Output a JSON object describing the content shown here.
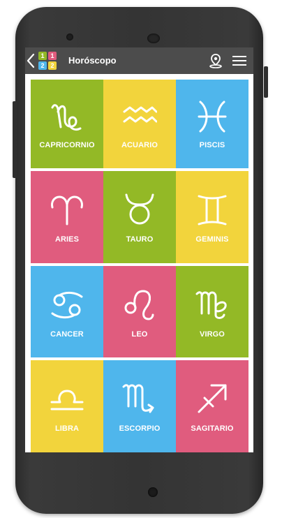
{
  "app": {
    "title": "Horóscopo",
    "logo_digits": [
      "1",
      "1",
      "2",
      "2"
    ]
  },
  "icons": {
    "back": "chevron-left-icon",
    "location": "location-pin-icon",
    "menu": "hamburger-menu-icon"
  },
  "colors": {
    "green": "#93b926",
    "yellow": "#f2d43c",
    "blue": "#4fb6ec",
    "pink": "#e05c7e",
    "appbar": "#4c4c4c"
  },
  "signs": [
    {
      "name": "CAPRICORNIO",
      "icon": "capricorn-icon",
      "color": "#93b926"
    },
    {
      "name": "ACUARIO",
      "icon": "aquarius-icon",
      "color": "#f2d43c"
    },
    {
      "name": "PISCIS",
      "icon": "pisces-icon",
      "color": "#4fb6ec"
    },
    {
      "name": "ARIES",
      "icon": "aries-icon",
      "color": "#e05c7e"
    },
    {
      "name": "TAURO",
      "icon": "taurus-icon",
      "color": "#93b926"
    },
    {
      "name": "GEMINIS",
      "icon": "gemini-icon",
      "color": "#f2d43c"
    },
    {
      "name": "CANCER",
      "icon": "cancer-icon",
      "color": "#4fb6ec"
    },
    {
      "name": "LEO",
      "icon": "leo-icon",
      "color": "#e05c7e"
    },
    {
      "name": "VIRGO",
      "icon": "virgo-icon",
      "color": "#93b926"
    },
    {
      "name": "LIBRA",
      "icon": "libra-icon",
      "color": "#f2d43c"
    },
    {
      "name": "ESCORPIO",
      "icon": "scorpio-icon",
      "color": "#4fb6ec"
    },
    {
      "name": "SAGITARIO",
      "icon": "sagittarius-icon",
      "color": "#e05c7e"
    }
  ]
}
